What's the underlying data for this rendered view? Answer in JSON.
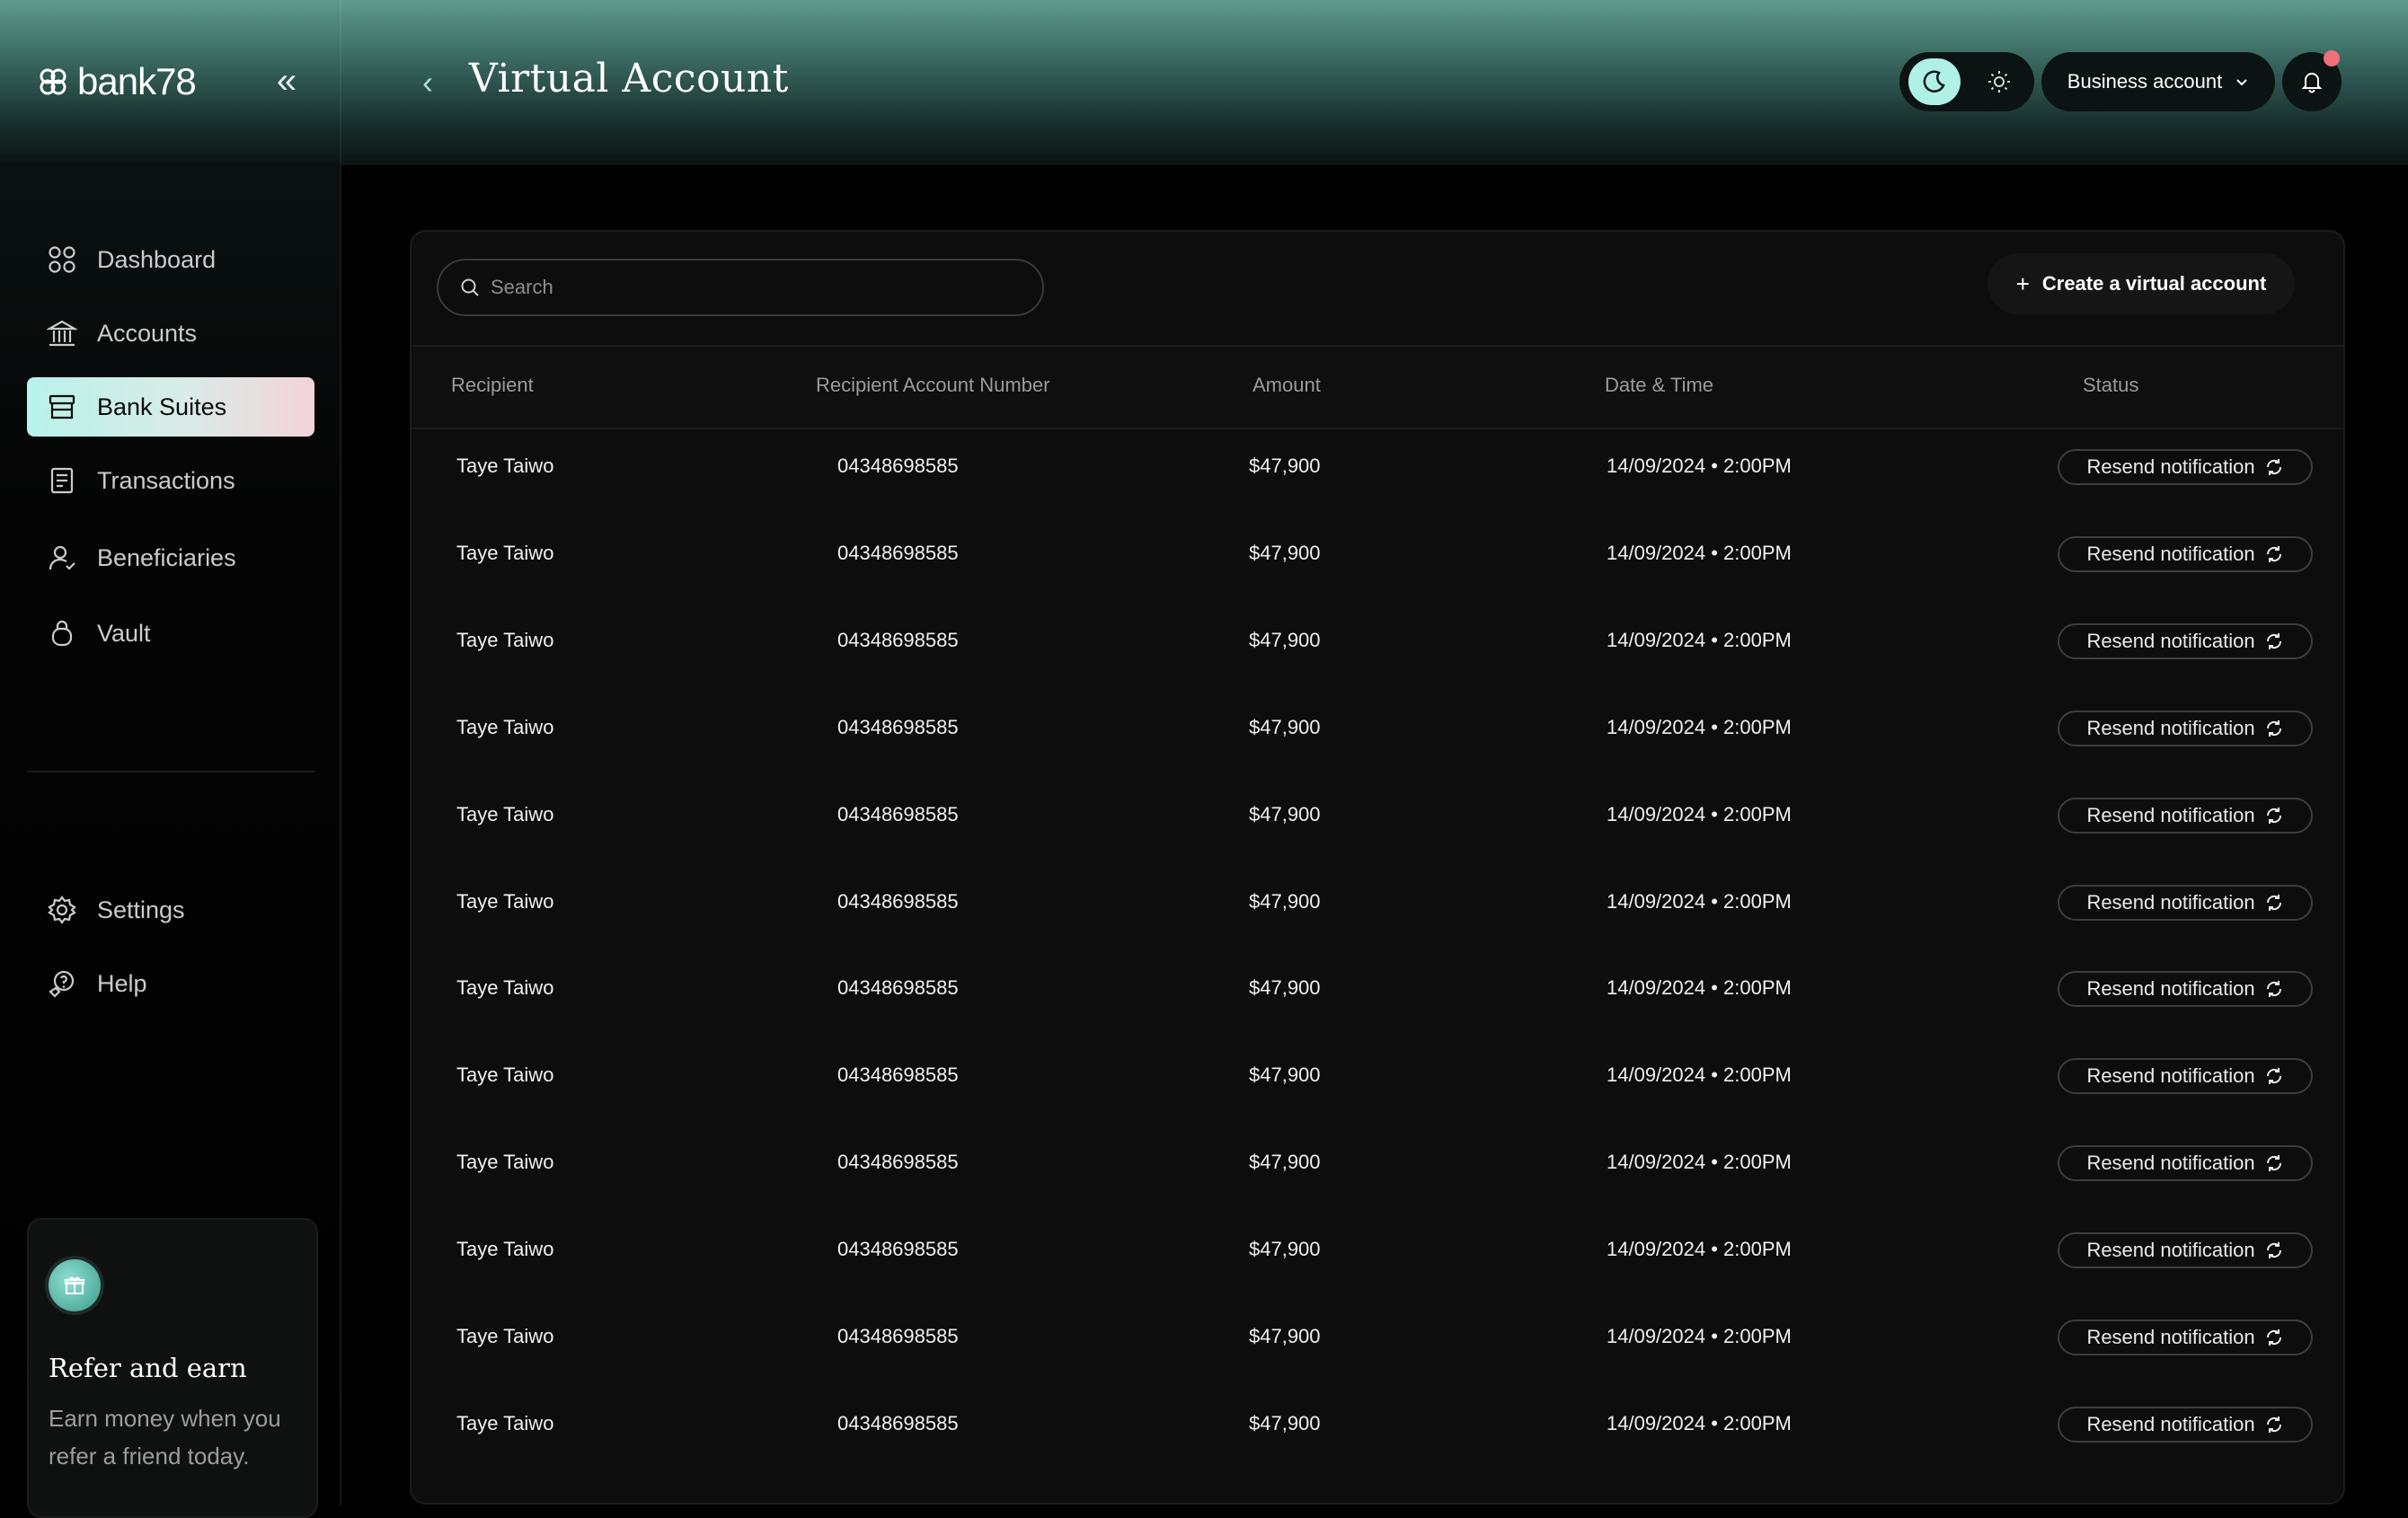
{
  "app": {
    "logo_text": "bank78"
  },
  "header": {
    "title": "Virtual Account",
    "account_selector": "Business account"
  },
  "sidebar": {
    "items": [
      {
        "label": "Dashboard",
        "icon": "dashboard-icon"
      },
      {
        "label": "Accounts",
        "icon": "bank-icon"
      },
      {
        "label": "Bank Suites",
        "icon": "store-icon",
        "active": true
      },
      {
        "label": "Transactions",
        "icon": "receipt-icon"
      },
      {
        "label": "Beneficiaries",
        "icon": "user-icon"
      },
      {
        "label": "Vault",
        "icon": "lock-icon"
      }
    ],
    "bottom_items": [
      {
        "label": "Settings",
        "icon": "gear-icon"
      },
      {
        "label": "Help",
        "icon": "help-icon"
      }
    ],
    "refer": {
      "title": "Refer and earn",
      "text": "Earn money when you refer a friend today."
    }
  },
  "main": {
    "search_placeholder": "Search",
    "create_button": "Create a virtual account",
    "columns": [
      "Recipient",
      "Recipient Account Number",
      "Amount",
      "Date & Time",
      "Status"
    ],
    "rows": [
      {
        "recipient": "Taye Taiwo",
        "account": "04348698585",
        "amount": "$47,900",
        "datetime": "14/09/2024 • 2:00PM",
        "status": "Resend notification"
      },
      {
        "recipient": "Taye Taiwo",
        "account": "04348698585",
        "amount": "$47,900",
        "datetime": "14/09/2024 • 2:00PM",
        "status": "Resend notification"
      },
      {
        "recipient": "Taye Taiwo",
        "account": "04348698585",
        "amount": "$47,900",
        "datetime": "14/09/2024 • 2:00PM",
        "status": "Resend notification"
      },
      {
        "recipient": "Taye Taiwo",
        "account": "04348698585",
        "amount": "$47,900",
        "datetime": "14/09/2024 • 2:00PM",
        "status": "Resend notification"
      },
      {
        "recipient": "Taye Taiwo",
        "account": "04348698585",
        "amount": "$47,900",
        "datetime": "14/09/2024 • 2:00PM",
        "status": "Resend notification"
      },
      {
        "recipient": "Taye Taiwo",
        "account": "04348698585",
        "amount": "$47,900",
        "datetime": "14/09/2024 • 2:00PM",
        "status": "Resend notification"
      },
      {
        "recipient": "Taye Taiwo",
        "account": "04348698585",
        "amount": "$47,900",
        "datetime": "14/09/2024 • 2:00PM",
        "status": "Resend notification"
      },
      {
        "recipient": "Taye Taiwo",
        "account": "04348698585",
        "amount": "$47,900",
        "datetime": "14/09/2024 • 2:00PM",
        "status": "Resend notification"
      },
      {
        "recipient": "Taye Taiwo",
        "account": "04348698585",
        "amount": "$47,900",
        "datetime": "14/09/2024 • 2:00PM",
        "status": "Resend notification"
      },
      {
        "recipient": "Taye Taiwo",
        "account": "04348698585",
        "amount": "$47,900",
        "datetime": "14/09/2024 • 2:00PM",
        "status": "Resend notification"
      },
      {
        "recipient": "Taye Taiwo",
        "account": "04348698585",
        "amount": "$47,900",
        "datetime": "14/09/2024 • 2:00PM",
        "status": "Resend notification"
      },
      {
        "recipient": "Taye Taiwo",
        "account": "04348698585",
        "amount": "$47,900",
        "datetime": "14/09/2024 • 2:00PM",
        "status": "Resend notification"
      }
    ]
  },
  "colors": {
    "accent": "#aff0e7",
    "notification_dot": "#ef6f7b",
    "background": "#000000",
    "panel": "#0d0d0d"
  }
}
